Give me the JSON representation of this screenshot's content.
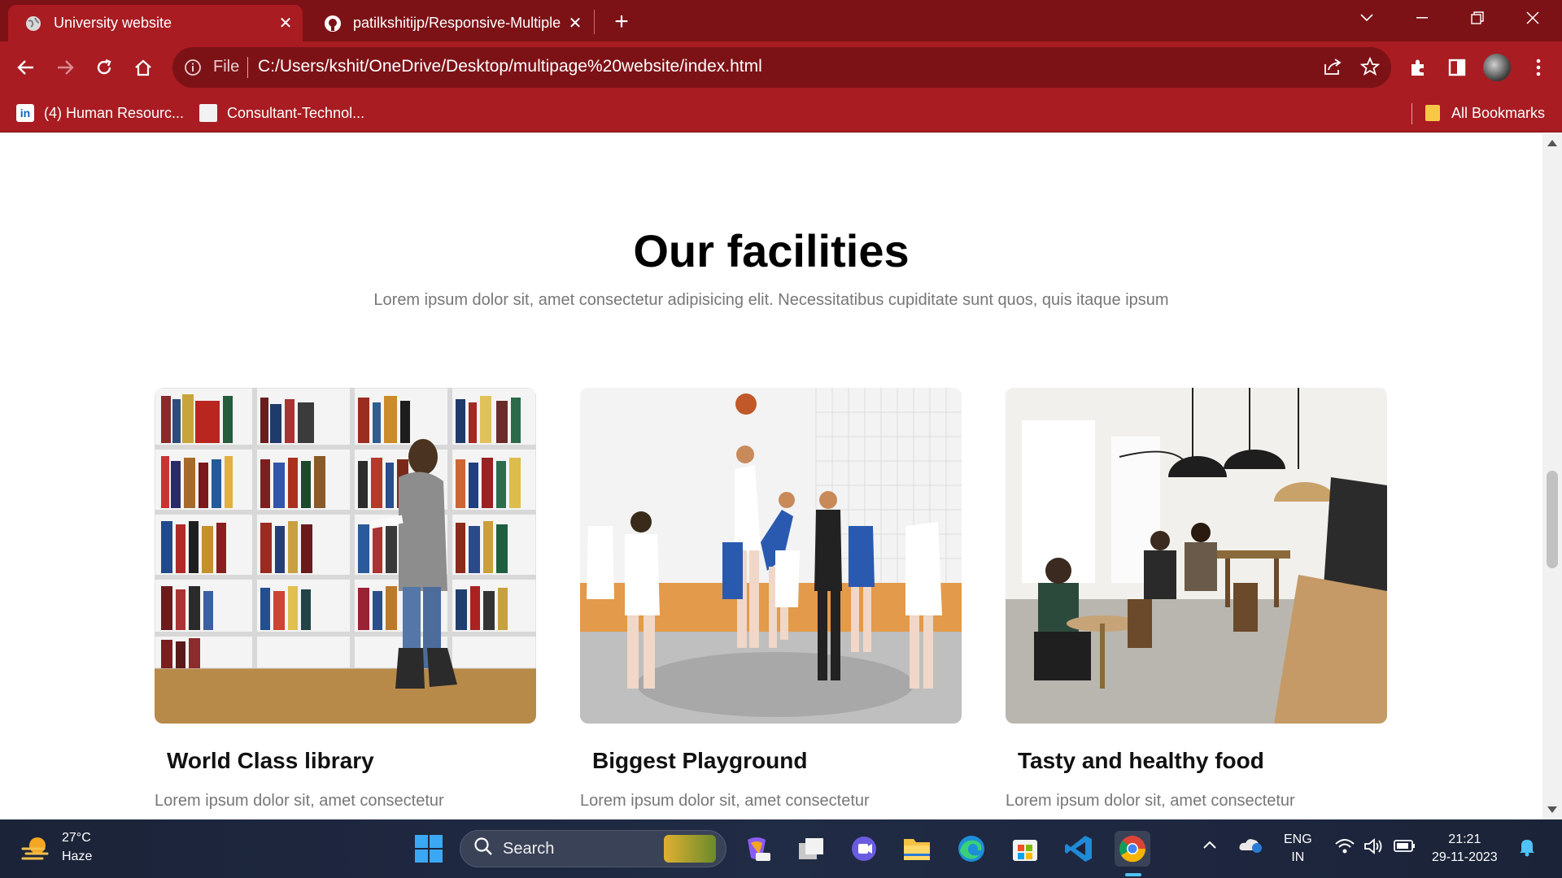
{
  "browser": {
    "tabs": [
      {
        "title": "University website",
        "active": true
      },
      {
        "title": "patilkshitijp/Responsive-Multiple",
        "active": false
      }
    ],
    "omnibox": {
      "scheme_label": "File",
      "url": "C:/Users/kshit/OneDrive/Desktop/multipage%20website/index.html"
    },
    "bookmarks": [
      {
        "label": "(4) Human Resourc...",
        "icon": "linkedin-icon"
      },
      {
        "label": "Consultant-Technol...",
        "icon": "site-icon"
      }
    ],
    "all_bookmarks": "All Bookmarks",
    "colors": {
      "frame": "#7d1216",
      "toolbar": "#a81c22"
    }
  },
  "page": {
    "heading": "Our facilities",
    "subtitle": "Lorem ipsum dolor sit, amet consectetur adipisicing elit. Necessitatibus cupiditate sunt quos, quis itaque ipsum",
    "cards": [
      {
        "title": "World Class library",
        "text": "Lorem ipsum dolor sit, amet consectetur",
        "image": "library-photo"
      },
      {
        "title": "Biggest Playground",
        "text": "Lorem ipsum dolor sit, amet consectetur",
        "image": "basketball-photo"
      },
      {
        "title": "Tasty and healthy food",
        "text": "Lorem ipsum dolor sit, amet consectetur",
        "image": "cafe-photo"
      }
    ]
  },
  "taskbar": {
    "weather": {
      "temp": "27°C",
      "desc": "Haze"
    },
    "search_placeholder": "Search",
    "language": {
      "line1": "ENG",
      "line2": "IN"
    },
    "clock": {
      "time": "21:21",
      "date": "29-11-2023"
    }
  }
}
